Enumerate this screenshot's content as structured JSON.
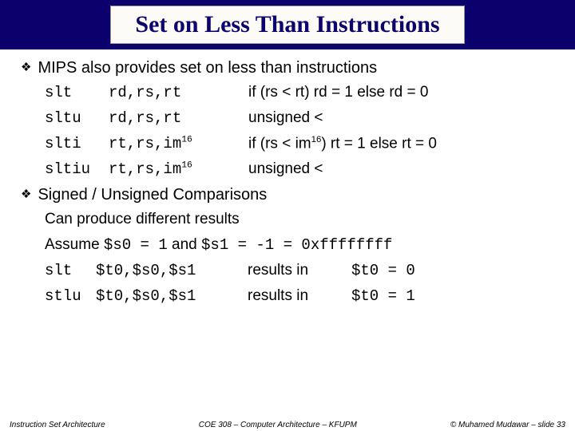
{
  "title": "Set on Less Than Instructions",
  "bullet1_a": "MIPS also provides ",
  "bullet1_b": "set on less than",
  "bullet1_c": " instructions",
  "instr": [
    {
      "mnemonic": "slt",
      "args": "rd,rs,rt",
      "desc_a": "if (rs < rt) rd = 1 else rd = 0",
      "sup": ""
    },
    {
      "mnemonic": "sltu",
      "args": "rd,rs,rt",
      "desc_a": "unsigned <",
      "sup": ""
    },
    {
      "mnemonic": "slti",
      "args_a": "rt,rs,im",
      "args_sup": "16",
      "desc_a": "if (rs < im",
      "desc_sup": "16",
      "desc_b": ") rt = 1 else rt = 0"
    },
    {
      "mnemonic": "sltiu",
      "args_a": "rt,rs,im",
      "args_sup": "16",
      "desc_a": "unsigned <",
      "desc_sup": "",
      "desc_b": ""
    }
  ],
  "bullet2_a": "Signed / Unsigned",
  "bullet2_b": " Comparisons",
  "sub1_a": "Can produce ",
  "sub1_b": "different",
  "sub1_c": " results",
  "sub2_a": "Assume ",
  "sub2_b": "$s0 = 1",
  "sub2_c": " and ",
  "sub2_d": "$s1 = -1 = 0xffffffff",
  "results": [
    {
      "mn": "slt",
      "args": "$t0,$s0,$s1",
      "mid": "results in",
      "out": "$t0 = 0"
    },
    {
      "mn": "stlu",
      "args": "$t0,$s0,$s1",
      "mid": "results in",
      "out": "$t0 = 1"
    }
  ],
  "footer": {
    "left": "Instruction Set Architecture",
    "center": "COE 308 – Computer Architecture – KFUPM",
    "right": "© Muhamed Mudawar – slide 33"
  }
}
